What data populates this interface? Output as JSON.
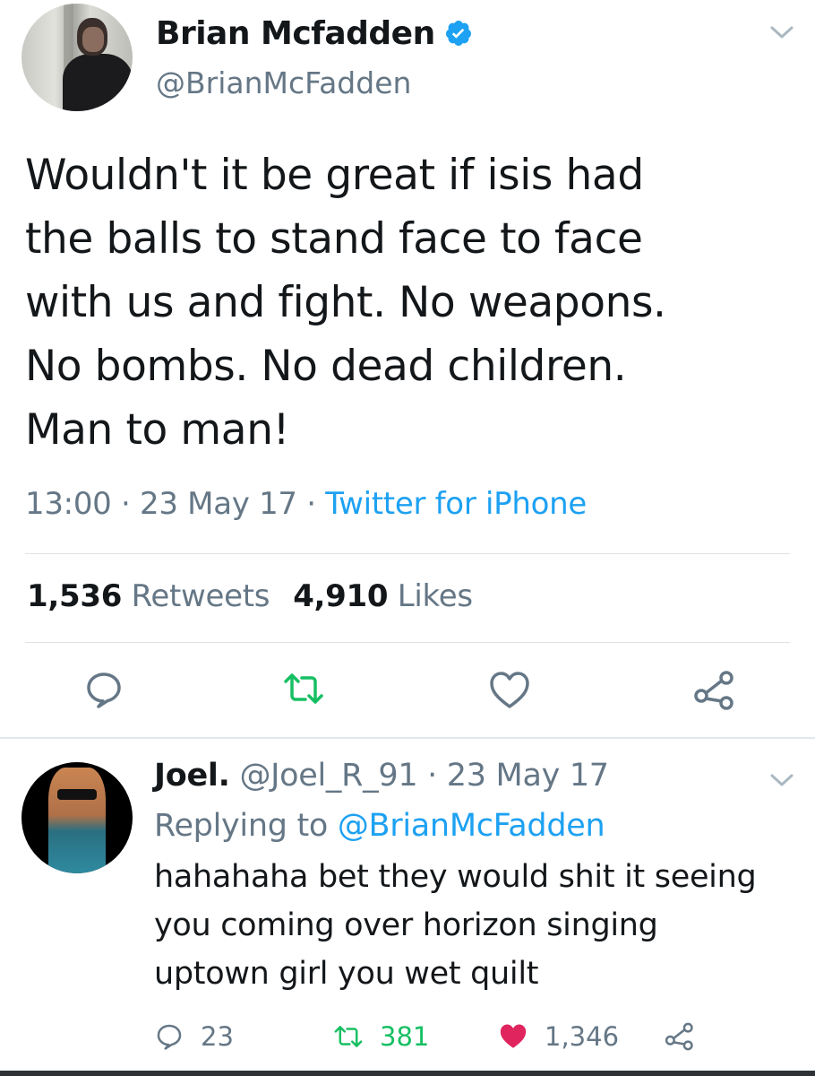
{
  "tweet": {
    "display_name": "Brian Mcfadden",
    "handle": "@BrianMcFadden",
    "text_lines": [
      "Wouldn't it be great if isis had",
      "the balls to stand face to face",
      "with us and fight. No weapons.",
      "No bombs. No dead children.",
      "Man to man!"
    ],
    "time": "13:00",
    "date": "23 May 17",
    "separator": " · ",
    "source": "Twitter for iPhone",
    "retweets_count": "1,536",
    "retweets_label": "Retweets",
    "likes_count": "4,910",
    "likes_label": "Likes"
  },
  "reply": {
    "display_name": "Joel.",
    "handle": "@Joel_R_91",
    "date": "23 May 17",
    "replying_prefix": "Replying to ",
    "replying_handle": "@BrianMcFadden",
    "text_lines": [
      "hahahaha bet they would shit it seeing",
      "you coming over horizon singing",
      "uptown girl you wet quilt"
    ],
    "reply_count": "23",
    "retweet_count": "381",
    "like_count": "1,346"
  },
  "colors": {
    "accent": "#1da1f2",
    "retweet_green": "#17bf63",
    "like_red": "#e0245e",
    "secondary_text": "#657786"
  },
  "icons": [
    "verified-badge-icon",
    "chevron-down-icon",
    "reply-icon",
    "retweet-icon",
    "heart-icon",
    "share-icon"
  ]
}
